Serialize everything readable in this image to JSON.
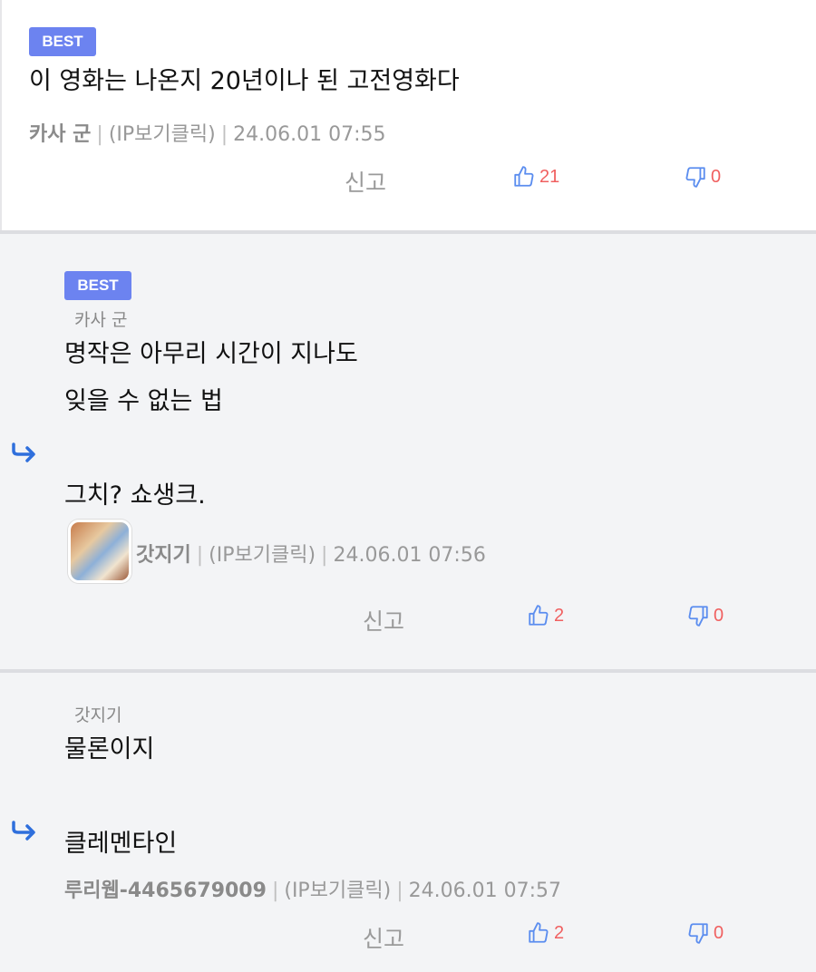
{
  "comments": [
    {
      "badge": "BEST",
      "text": "이 영화는 나온지 20년이나 된 고전영화다",
      "author": "카사 군",
      "ip": "(IP보기클릭)",
      "datetime": "24.06.01 07:55",
      "report_label": "신고",
      "likes": "21",
      "dislikes": "0"
    },
    {
      "badge": "BEST",
      "reply_to": "카사 군",
      "text": "명작은 아무리 시간이 지나도\n잊을 수 없는 법\n\n그치? 쇼생크.",
      "author": "갓지기",
      "ip": "(IP보기클릭)",
      "datetime": "24.06.01 07:56",
      "report_label": "신고",
      "likes": "2",
      "dislikes": "0"
    },
    {
      "reply_to": "갓지기",
      "text": "물론이지\n\n클레멘타인",
      "author": "루리웹-4465679009",
      "ip": "(IP보기클릭)",
      "datetime": "24.06.01 07:57",
      "report_label": "신고",
      "likes": "2",
      "dislikes": "0"
    }
  ],
  "icons": {
    "like": "thumbs-up-icon",
    "dislike": "thumbs-down-icon",
    "reply": "reply-arrow-icon"
  },
  "colors": {
    "badge": "#6c83f0",
    "vote_count": "#f06060",
    "reply_arrow": "#2f6fdc",
    "thumb_icon": "#5b8def"
  }
}
